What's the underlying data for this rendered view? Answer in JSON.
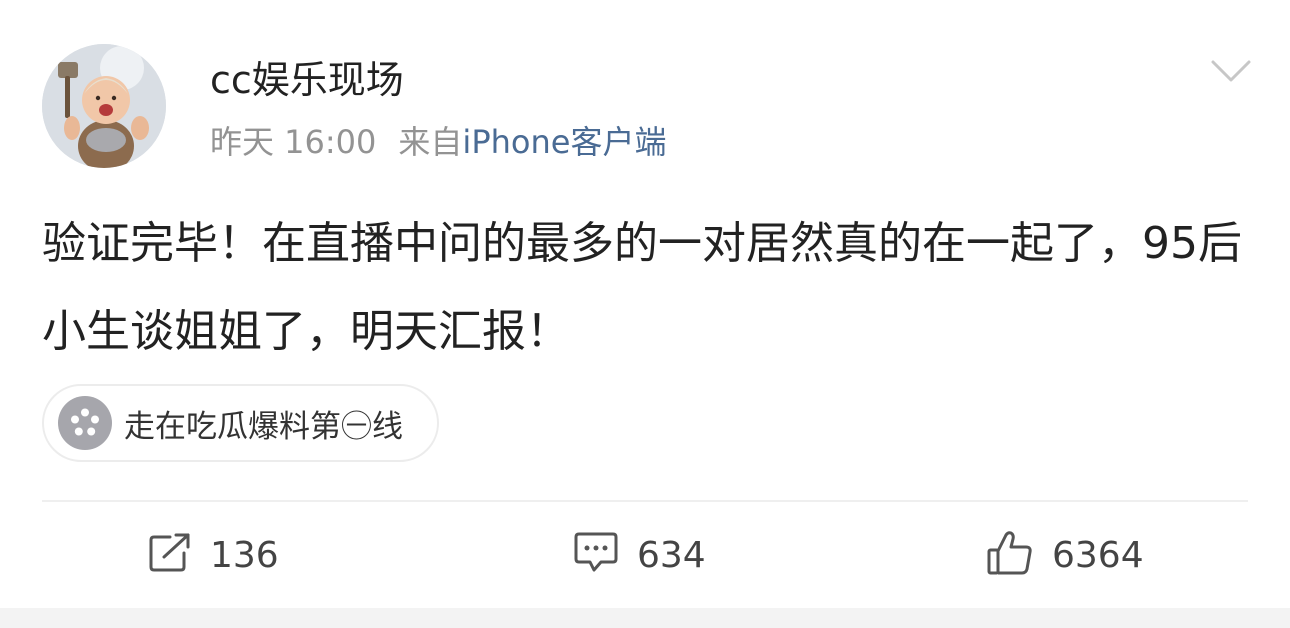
{
  "post": {
    "author": "cc娱乐现场",
    "time": "昨天 16:00",
    "source_prefix": "来自",
    "source_device": "iPhone客户端",
    "text": "验证完毕！在直播中问的最多的一对居然真的在一起了，95后小生谈姐姐了，明天汇报！",
    "topic": "走在吃瓜爆料第㊀线"
  },
  "actions": {
    "repost_count": "136",
    "comment_count": "634",
    "like_count": "6364"
  },
  "icons": {
    "menu": "chevron-down-icon",
    "topic": "flower-icon",
    "repost": "share-icon",
    "comment": "comment-icon",
    "like": "thumbs-up-icon"
  },
  "colors": {
    "text": "#222222",
    "meta": "#939393",
    "device_link": "#4a6b94",
    "topic_icon": "#a6a6ac",
    "divider": "#efefef"
  }
}
